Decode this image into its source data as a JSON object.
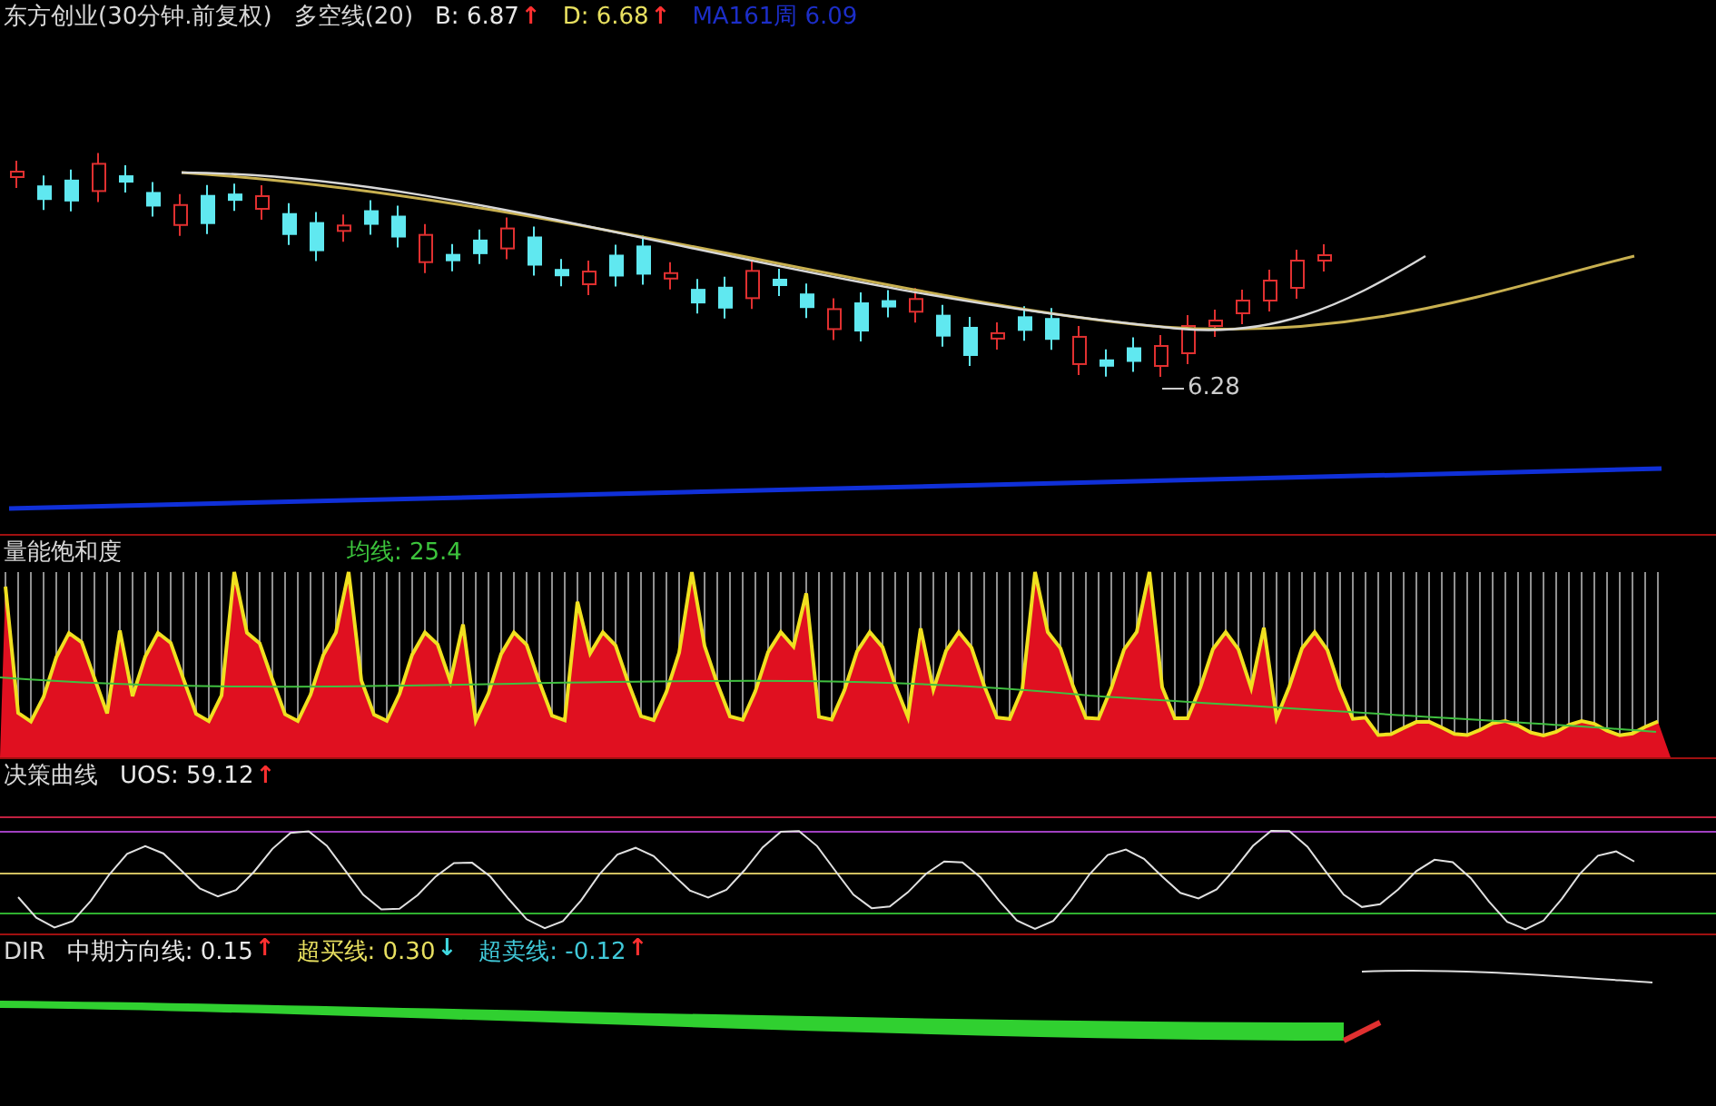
{
  "main_panel": {
    "title": "东方创业(30分钟.前复权)",
    "indicator": "多空线(20)",
    "readouts": [
      {
        "text": "B: 6.87",
        "arrow": {
          "text": "↑",
          "color": "#ff3030"
        },
        "color": "#e8e8e8"
      },
      {
        "text": "D: 6.68",
        "arrow": {
          "text": "↑",
          "color": "#ff3030"
        },
        "color": "#e8e060"
      },
      {
        "text": "MA161周 6.09",
        "color": "#1c2ec8"
      }
    ],
    "low_label": "6.28"
  },
  "volume_panel": {
    "title": "量能饱和度",
    "readouts": [
      {
        "text": "均线: 25.4",
        "color": "#3cc43c"
      }
    ]
  },
  "uos_panel": {
    "title": "决策曲线",
    "readouts": [
      {
        "text": "UOS: 59.12",
        "arrow": {
          "text": "↑",
          "color": "#ff3030"
        },
        "color": "#e8e8e8"
      }
    ]
  },
  "dir_panel": {
    "title": "DIR",
    "readouts": [
      {
        "text": "中期方向线: 0.15",
        "arrow": {
          "text": "↑",
          "color": "#ff3030"
        },
        "color": "#e8e8e8"
      },
      {
        "text": "超买线: 0.30",
        "arrow": {
          "text": "↓",
          "color": "#40d8e0"
        },
        "color": "#e8e060"
      },
      {
        "text": "超卖线: -0.12",
        "arrow": {
          "text": "↑",
          "color": "#ff3030"
        },
        "color": "#40c8d8"
      }
    ]
  }
}
